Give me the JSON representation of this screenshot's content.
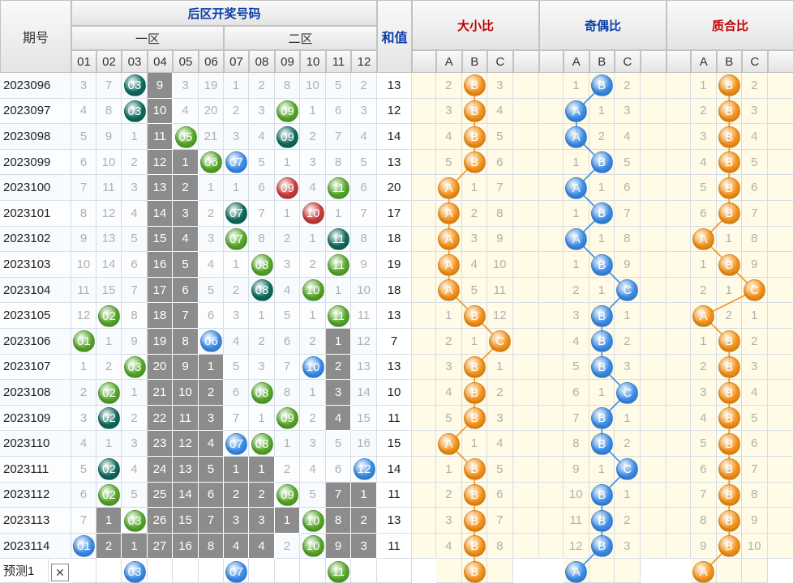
{
  "header": {
    "period_label": "期号",
    "back_zone_label": "后区开奖号码",
    "zone1_label": "一区",
    "zone2_label": "二区",
    "sum_label": "和值",
    "size_ratio_label": "大小比",
    "parity_ratio_label": "奇偶比",
    "prime_ratio_label": "质合比",
    "numbers": [
      "01",
      "02",
      "03",
      "04",
      "05",
      "06",
      "07",
      "08",
      "09",
      "10",
      "11",
      "12"
    ],
    "abc": [
      "A",
      "B",
      "C"
    ]
  },
  "colors": {
    "blue": "#3a8be6",
    "green": "#55a628",
    "dark_teal": "#0e6a5d",
    "red": "#c83c3a",
    "orange": "#f39119",
    "gray": "#8a8a8a",
    "accent_text": "#0a3ea8",
    "red_text": "#c00000"
  },
  "rows": [
    {
      "period": "2023096",
      "nums": [
        "3",
        "7",
        "03",
        "9",
        "3",
        "19",
        "1",
        "2",
        "8",
        "10",
        "5",
        "2"
      ],
      "sum": "13",
      "size": [
        "2",
        "B",
        "3"
      ],
      "parity": [
        "1",
        "B",
        "2"
      ],
      "prime": [
        "1",
        "B",
        "2"
      ]
    },
    {
      "period": "2023097",
      "nums": [
        "4",
        "8",
        "03",
        "10",
        "4",
        "20",
        "2",
        "3",
        "09",
        "1",
        "6",
        "3"
      ],
      "sum": "12",
      "size": [
        "3",
        "B",
        "4"
      ],
      "parity": [
        "A",
        "1",
        "3"
      ],
      "prime": [
        "2",
        "B",
        "3"
      ]
    },
    {
      "period": "2023098",
      "nums": [
        "5",
        "9",
        "1",
        "11",
        "05",
        "21",
        "3",
        "4",
        "09",
        "2",
        "7",
        "4"
      ],
      "sum": "14",
      "size": [
        "4",
        "B",
        "5"
      ],
      "parity": [
        "A",
        "2",
        "4"
      ],
      "prime": [
        "3",
        "B",
        "4"
      ]
    },
    {
      "period": "2023099",
      "nums": [
        "6",
        "10",
        "2",
        "12",
        "1",
        "06",
        "07",
        "5",
        "1",
        "3",
        "8",
        "5"
      ],
      "sum": "13",
      "size": [
        "5",
        "B",
        "6"
      ],
      "parity": [
        "1",
        "B",
        "5"
      ],
      "prime": [
        "4",
        "B",
        "5"
      ]
    },
    {
      "period": "2023100",
      "nums": [
        "7",
        "11",
        "3",
        "13",
        "2",
        "1",
        "1",
        "6",
        "09",
        "4",
        "11",
        "6"
      ],
      "sum": "20",
      "size": [
        "A",
        "1",
        "7"
      ],
      "parity": [
        "A",
        "1",
        "6"
      ],
      "prime": [
        "5",
        "B",
        "6"
      ]
    },
    {
      "period": "2023101",
      "nums": [
        "8",
        "12",
        "4",
        "14",
        "3",
        "2",
        "07",
        "7",
        "1",
        "10",
        "1",
        "7"
      ],
      "sum": "17",
      "size": [
        "A",
        "2",
        "8"
      ],
      "parity": [
        "1",
        "B",
        "7"
      ],
      "prime": [
        "6",
        "B",
        "7"
      ]
    },
    {
      "period": "2023102",
      "nums": [
        "9",
        "13",
        "5",
        "15",
        "4",
        "3",
        "07",
        "8",
        "2",
        "1",
        "11",
        "8"
      ],
      "sum": "18",
      "size": [
        "A",
        "3",
        "9"
      ],
      "parity": [
        "A",
        "1",
        "8"
      ],
      "prime": [
        "A",
        "1",
        "8"
      ]
    },
    {
      "period": "2023103",
      "nums": [
        "10",
        "14",
        "6",
        "16",
        "5",
        "4",
        "1",
        "08",
        "3",
        "2",
        "11",
        "9"
      ],
      "sum": "19",
      "size": [
        "A",
        "4",
        "10"
      ],
      "parity": [
        "1",
        "B",
        "9"
      ],
      "prime": [
        "1",
        "B",
        "9"
      ]
    },
    {
      "period": "2023104",
      "nums": [
        "11",
        "15",
        "7",
        "17",
        "6",
        "5",
        "2",
        "08",
        "4",
        "10",
        "1",
        "10"
      ],
      "sum": "18",
      "size": [
        "A",
        "5",
        "11"
      ],
      "parity": [
        "2",
        "1",
        "C"
      ],
      "prime": [
        "2",
        "1",
        "C"
      ]
    },
    {
      "period": "2023105",
      "nums": [
        "12",
        "02",
        "8",
        "18",
        "7",
        "6",
        "3",
        "1",
        "5",
        "1",
        "11",
        "11"
      ],
      "sum": "13",
      "size": [
        "1",
        "B",
        "12"
      ],
      "parity": [
        "3",
        "B",
        "1"
      ],
      "prime": [
        "A",
        "2",
        "1"
      ]
    },
    {
      "period": "2023106",
      "nums": [
        "01",
        "1",
        "9",
        "19",
        "8",
        "06",
        "4",
        "2",
        "6",
        "2",
        "1",
        "12"
      ],
      "sum": "7",
      "size": [
        "2",
        "1",
        "C"
      ],
      "parity": [
        "4",
        "B",
        "2"
      ],
      "prime": [
        "1",
        "B",
        "2"
      ]
    },
    {
      "period": "2023107",
      "nums": [
        "1",
        "2",
        "03",
        "20",
        "9",
        "1",
        "5",
        "3",
        "7",
        "10",
        "2",
        "13"
      ],
      "sum": "13",
      "size": [
        "3",
        "B",
        "1"
      ],
      "parity": [
        "5",
        "B",
        "3"
      ],
      "prime": [
        "2",
        "B",
        "3"
      ]
    },
    {
      "period": "2023108",
      "nums": [
        "2",
        "02",
        "1",
        "21",
        "10",
        "2",
        "6",
        "08",
        "8",
        "1",
        "3",
        "14"
      ],
      "sum": "10",
      "size": [
        "4",
        "B",
        "2"
      ],
      "parity": [
        "6",
        "1",
        "C"
      ],
      "prime": [
        "3",
        "B",
        "4"
      ]
    },
    {
      "period": "2023109",
      "nums": [
        "3",
        "02",
        "2",
        "22",
        "11",
        "3",
        "7",
        "1",
        "09",
        "2",
        "4",
        "15"
      ],
      "sum": "11",
      "size": [
        "5",
        "B",
        "3"
      ],
      "parity": [
        "7",
        "B",
        "1"
      ],
      "prime": [
        "4",
        "B",
        "5"
      ]
    },
    {
      "period": "2023110",
      "nums": [
        "4",
        "1",
        "3",
        "23",
        "12",
        "4",
        "07",
        "08",
        "1",
        "3",
        "5",
        "16"
      ],
      "sum": "15",
      "size": [
        "A",
        "1",
        "4"
      ],
      "parity": [
        "8",
        "B",
        "2"
      ],
      "prime": [
        "5",
        "B",
        "6"
      ]
    },
    {
      "period": "2023111",
      "nums": [
        "5",
        "02",
        "4",
        "24",
        "13",
        "5",
        "1",
        "1",
        "2",
        "4",
        "6",
        "12"
      ],
      "sum": "14",
      "size": [
        "1",
        "B",
        "5"
      ],
      "parity": [
        "9",
        "1",
        "C"
      ],
      "prime": [
        "6",
        "B",
        "7"
      ]
    },
    {
      "period": "2023112",
      "nums": [
        "6",
        "02",
        "5",
        "25",
        "14",
        "6",
        "2",
        "2",
        "09",
        "5",
        "7",
        "1"
      ],
      "sum": "11",
      "size": [
        "2",
        "B",
        "6"
      ],
      "parity": [
        "10",
        "B",
        "1"
      ],
      "prime": [
        "7",
        "B",
        "8"
      ]
    },
    {
      "period": "2023113",
      "nums": [
        "7",
        "1",
        "03",
        "26",
        "15",
        "7",
        "3",
        "3",
        "1",
        "10",
        "8",
        "2"
      ],
      "sum": "13",
      "size": [
        "3",
        "B",
        "7"
      ],
      "parity": [
        "11",
        "B",
        "2"
      ],
      "prime": [
        "8",
        "B",
        "9"
      ]
    },
    {
      "period": "2023114",
      "nums": [
        "01",
        "2",
        "1",
        "27",
        "16",
        "8",
        "4",
        "4",
        "2",
        "10",
        "9",
        "3"
      ],
      "sum": "11",
      "size": [
        "4",
        "B",
        "8"
      ],
      "parity": [
        "12",
        "B",
        "3"
      ],
      "prime": [
        "9",
        "B",
        "10"
      ]
    }
  ],
  "forecast": {
    "label": "预测1",
    "close": "✕",
    "nums": [
      "03",
      "07",
      "11"
    ],
    "size": "B",
    "parity": "A",
    "prime": "A"
  }
}
